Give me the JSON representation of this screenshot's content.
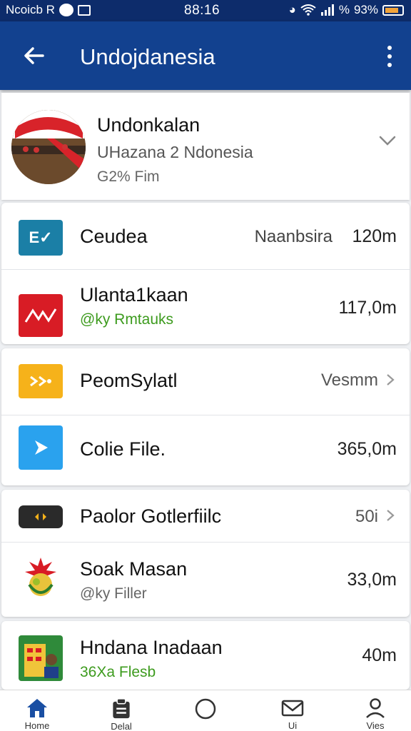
{
  "status_bar": {
    "left_text": "Ncoicb R",
    "time": "88:16",
    "right_text": "%",
    "battery": "93%"
  },
  "app_bar": {
    "title": "Undojdanesia",
    "back_icon": "arrow-left-icon",
    "more_icon": "more-vertical-icon"
  },
  "profile": {
    "name": "Undonkalan",
    "subtitle": "UHazana 2 Ndonesia",
    "meta": "G2% Fim"
  },
  "groups": [
    {
      "rows": [
        {
          "title": "Ceudea",
          "middle": "Naanbsira",
          "right": "120m",
          "icon": "ev-icon",
          "icon_color": "#1b7fa6"
        },
        {
          "title": "Ulanta1kaan",
          "subtitle": "@ky Rmtauks",
          "subtitle_color": "#3d9b1e",
          "right": "117,0m",
          "icon": "red-logo-icon",
          "icon_color": "#d81c25"
        }
      ]
    },
    {
      "rows": [
        {
          "title": "PeomSylatl",
          "right": "Vesmm",
          "icon": "yellow-app-icon",
          "icon_color": "#f6b21a"
        },
        {
          "title": "Colie File.",
          "right": "365,0m",
          "icon": "play-icon",
          "icon_color": "#2aa2ee"
        }
      ]
    },
    {
      "rows": [
        {
          "title": "Paolor Gotlerfiilc",
          "right": "50i",
          "icon": "dark-app-icon",
          "icon_color": "#2a2a2a"
        },
        {
          "title": "Soak Masan",
          "subtitle": "@ky Filler",
          "subtitle_color": "#666666",
          "right": "33,0m",
          "icon": "garuda-icon",
          "icon_color": "#ffffff"
        }
      ]
    },
    {
      "rows": [
        {
          "title": "Hndana Inadaan",
          "subtitle": "36Xa Flesb",
          "subtitle_color": "#3d9b1e",
          "right": "40m",
          "icon": "building-person-icon",
          "icon_color": "#2f8a3a"
        }
      ]
    }
  ],
  "bottom_nav": [
    {
      "label": "Home",
      "icon": "home-icon",
      "active": true
    },
    {
      "label": "Delal",
      "icon": "clipboard-icon",
      "active": false
    },
    {
      "label": "",
      "icon": "circle-icon",
      "active": false
    },
    {
      "label": "Ui",
      "icon": "mail-icon",
      "active": false
    },
    {
      "label": "Vies",
      "icon": "profile-icon",
      "active": false
    }
  ],
  "colors": {
    "app_bar": "#12418f",
    "status_bar": "#0d2c6b",
    "accent_green": "#3d9b1e",
    "nav_active": "#1a4fa3"
  }
}
